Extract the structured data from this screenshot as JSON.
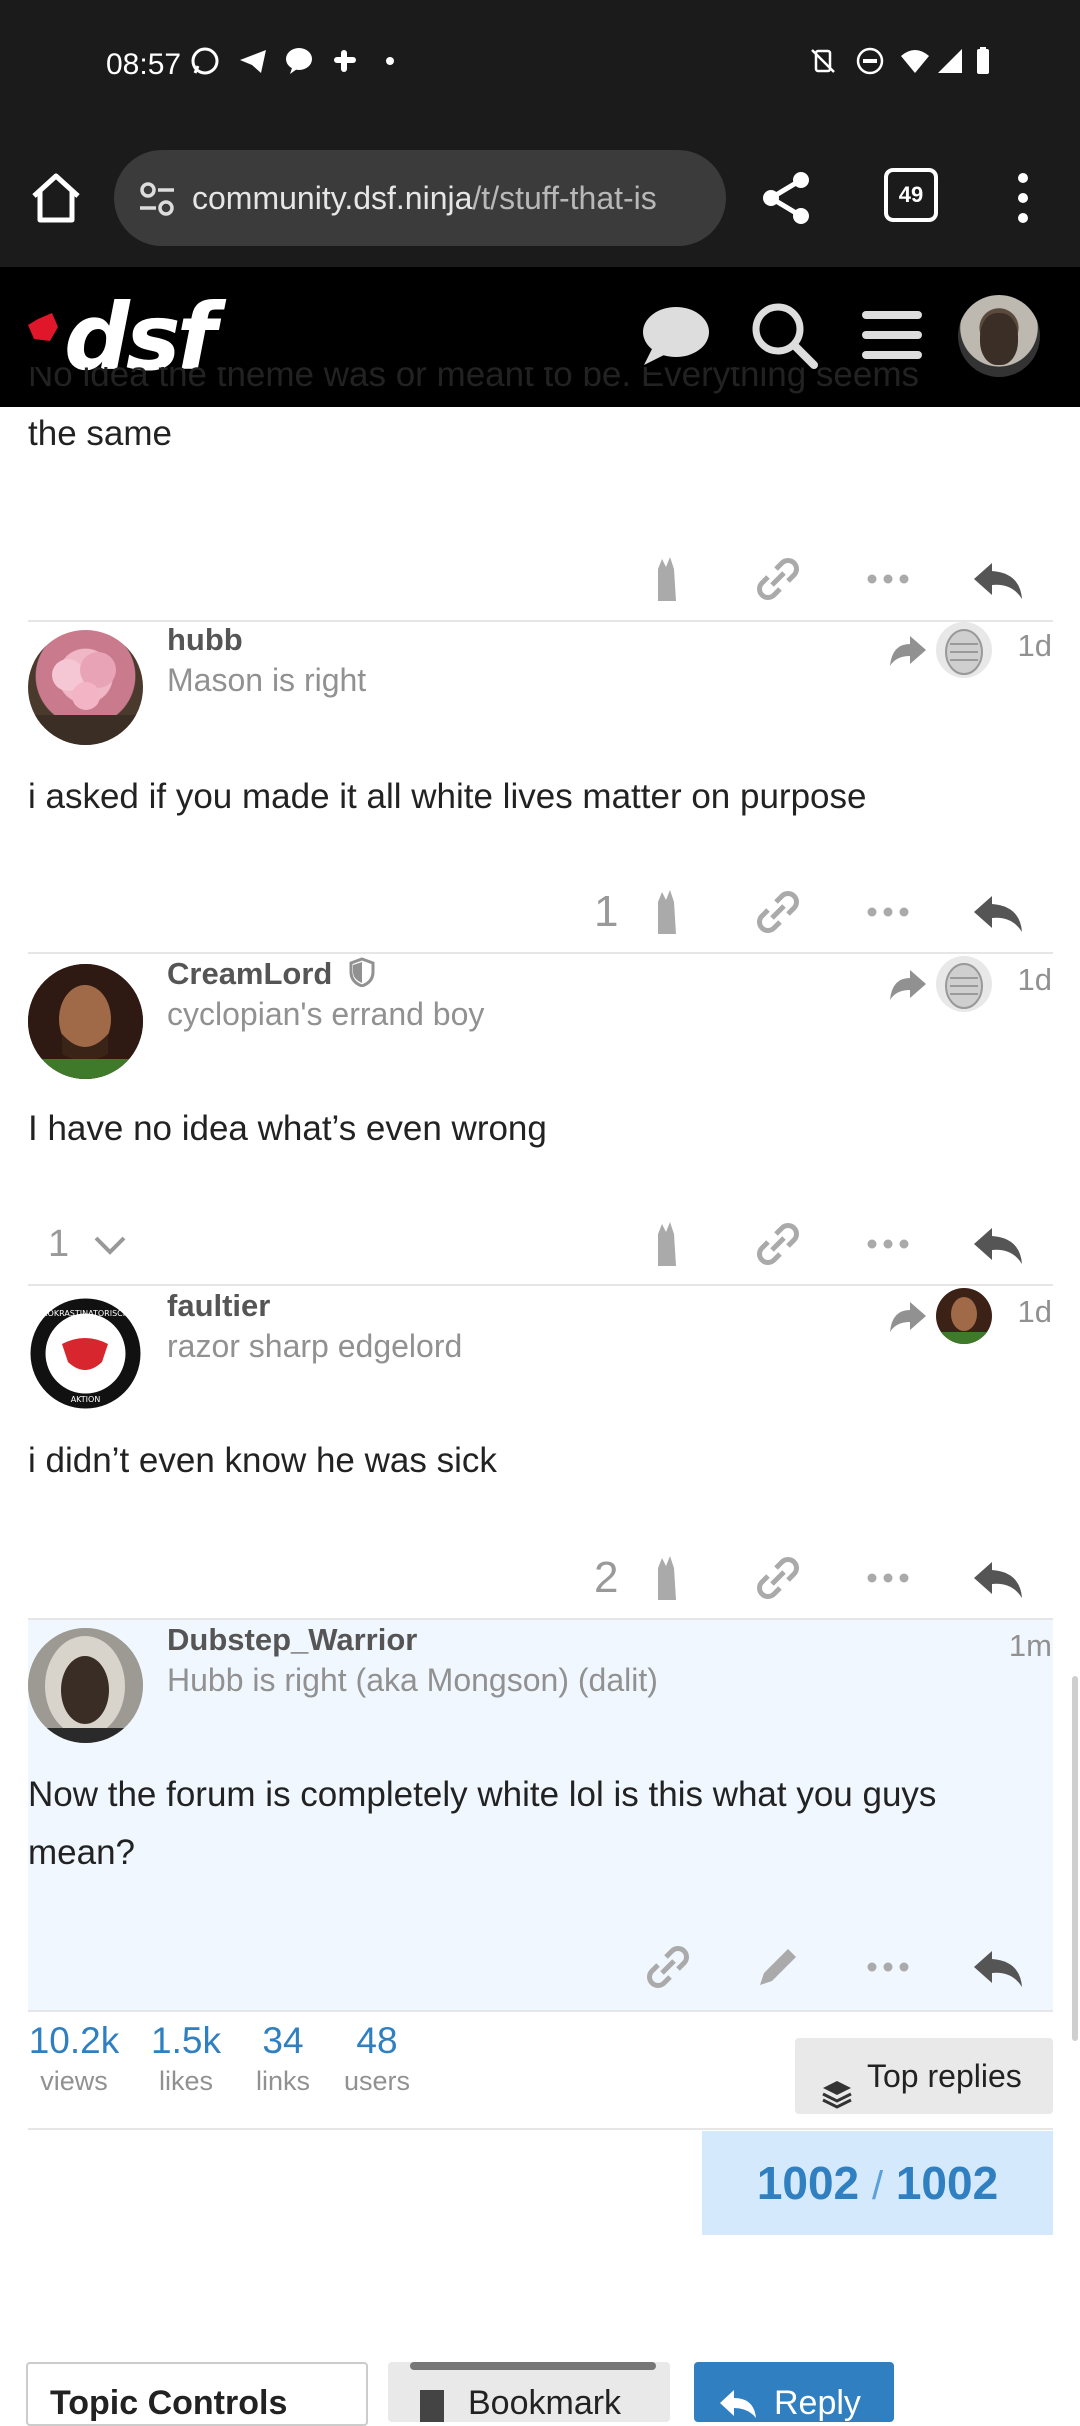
{
  "status_bar": {
    "time": "08:57",
    "notification_icons": [
      "whatsapp-icon",
      "telegram-icon",
      "messenger-icon",
      "slack-icon",
      "dot-icon"
    ],
    "system_icons": [
      "vibrate-off-icon",
      "dnd-icon",
      "wifi-icon",
      "signal-icon",
      "battery-icon"
    ]
  },
  "browser": {
    "url_host": "community.dsf.ninja",
    "url_path": "/t/stuff-that-is",
    "tab_count": "49"
  },
  "site": {
    "logo_text": "dsf"
  },
  "partial_post": {
    "text_cut": "No idea the theme was or meant to be. Everything seems",
    "text_line2": "the same"
  },
  "posts": [
    {
      "username": "hubb",
      "title": "Mason is right",
      "date": "1d",
      "body": "i asked if you made it all white lives matter on purpose",
      "likes": "1"
    },
    {
      "username": "CreamLord",
      "title": "cyclopian's errand boy",
      "date": "1d",
      "body": "I have no idea what’s even wrong",
      "replies": "1"
    },
    {
      "username": "faultier",
      "title": "razor sharp edgelord",
      "date": "1d",
      "body": "i didn’t even know he was sick",
      "likes": "2",
      "avatar_text_top": "PROKRASTINATORISCHE",
      "avatar_text_bottom": "AKTION"
    },
    {
      "username": "Dubstep_Warrior",
      "title": "Hubb is right (aka Mongson) (dalit)",
      "date": "1m",
      "body": "Now the forum is completely white lol is this what you guys mean?"
    }
  ],
  "topic_stats": {
    "views_num": "10.2k",
    "views_label": "views",
    "likes_num": "1.5k",
    "likes_label": "likes",
    "links_num": "34",
    "links_label": "links",
    "users_num": "48",
    "users_label": "users"
  },
  "top_replies_label": "Top replies",
  "progress": {
    "current": "1002",
    "separator": "/",
    "total": "1002"
  },
  "bottom_buttons": {
    "topic_controls": "Topic Controls",
    "bookmark": "Bookmark",
    "reply": "Reply"
  },
  "colors": {
    "accent": "#2f7fc1",
    "header_bg": "#000000",
    "highlight_bg": "#f0f7ff",
    "progress_bg": "#d4e9fb"
  }
}
